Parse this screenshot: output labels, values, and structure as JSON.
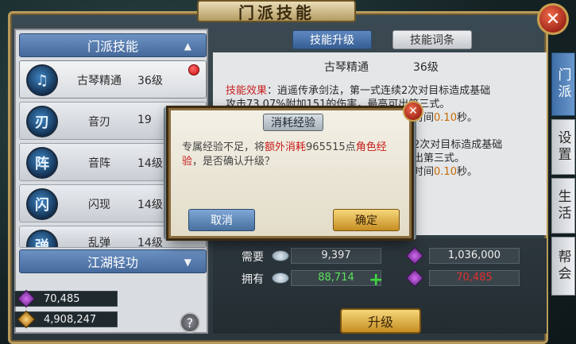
{
  "window": {
    "title": "门派技能",
    "close_icon": "close-icon"
  },
  "left": {
    "section1_title": "门派技能",
    "section2_title": "江湖轻功",
    "skills": [
      {
        "glyph": "",
        "name": "古琴精通",
        "level": "36级",
        "alert": true
      },
      {
        "glyph": "刃",
        "name": "音刃",
        "level": "19",
        "alert": true
      },
      {
        "glyph": "阵",
        "name": "音阵",
        "level": "14级",
        "alert": false
      },
      {
        "glyph": "闪",
        "name": "闪现",
        "level": "14级",
        "alert": false
      },
      {
        "glyph": "弹",
        "name": "乱弹",
        "level": "14级",
        "alert": false
      }
    ],
    "resources": [
      {
        "icon": "purple-gem-icon",
        "value": "70,485"
      },
      {
        "icon": "gold-coin-icon",
        "value": "4,908,247"
      }
    ],
    "help": "?"
  },
  "tabs": {
    "active": "技能升级",
    "inactive": "技能词条"
  },
  "detail": {
    "skill_name": "古琴精通",
    "skill_level": "36级",
    "effect_label": "技能效果",
    "effect_line1": "：逍遥传承剑法，第一式连续2次对目标造成基础",
    "effect_line2": "攻击73.07%附加151的伤害，",
    "effect_line2b": "最高可",
    "effect_line2c": "出第三式。",
    "effect_line3a": "时间",
    "effect_line3b": "0.10",
    "effect_line3c": "秒。",
    "effect_line4": "2次对目标造成基础",
    "effect_line5": "出第三式。",
    "effect_line6a": "时间",
    "effect_line6b": "0.10",
    "effect_line6c": "秒。"
  },
  "cost": {
    "need_label": "需要",
    "have_label": "拥有",
    "need_silver": "9,397",
    "need_gem": "1,036,000",
    "have_silver": "88,714",
    "have_gem": "70,485"
  },
  "upgrade_button": "升级",
  "side_tabs": [
    "门派",
    "设置",
    "生活",
    "帮会"
  ],
  "dialog": {
    "title": "消耗经验",
    "msg_part1": "专属经验不足，将",
    "msg_red1": "额外消耗",
    "msg_num": "965515",
    "msg_part2": "点",
    "msg_red2": "角色经验",
    "msg_part3": "，是否确认升级？",
    "cancel": "取消",
    "confirm": "确定"
  },
  "colors": {
    "accent_blue": "#46699b",
    "alert_red": "#c80e0e",
    "gold": "#c58d22",
    "green_ok": "#3fd83f"
  }
}
